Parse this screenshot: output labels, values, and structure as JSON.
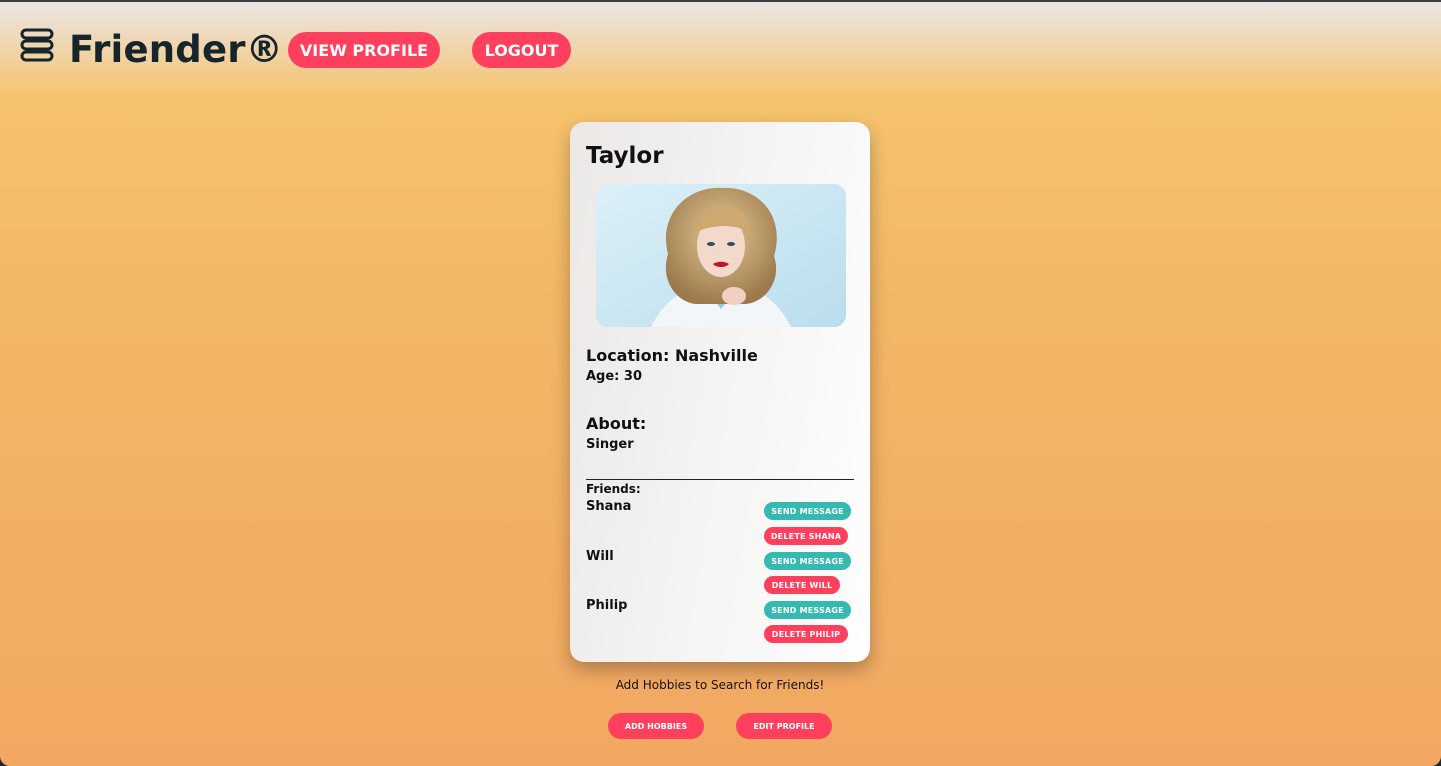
{
  "app": {
    "brand": "Friender®",
    "menu_icon": "menu-icon"
  },
  "header": {
    "view_profile_label": "VIEW PROFILE",
    "logout_label": "LOGOUT"
  },
  "profile": {
    "name": "Taylor",
    "photo_icon": "profile-photo",
    "location": "Location: Nashville",
    "age": "Age: 30",
    "about_heading": "About:",
    "about_text": "Singer",
    "friends_heading": "Friends:",
    "friends": [
      {
        "name": "Shana",
        "message_label": "SEND MESSAGE",
        "delete_label": "DELETE SHANA"
      },
      {
        "name": "Will",
        "message_label": "SEND MESSAGE",
        "delete_label": "DELETE WILL"
      },
      {
        "name": "Philip",
        "message_label": "SEND MESSAGE",
        "delete_label": "DELETE PHILIP"
      }
    ]
  },
  "footer": {
    "hint": "Add Hobbies to Search for Friends!",
    "add_hobbies_label": "ADD HOBBIES",
    "edit_profile_label": "EDIT PROFILE"
  },
  "colors": {
    "accent": "#fe3f5e",
    "teal": "#35b9b1",
    "brand_text": "#16242b"
  }
}
